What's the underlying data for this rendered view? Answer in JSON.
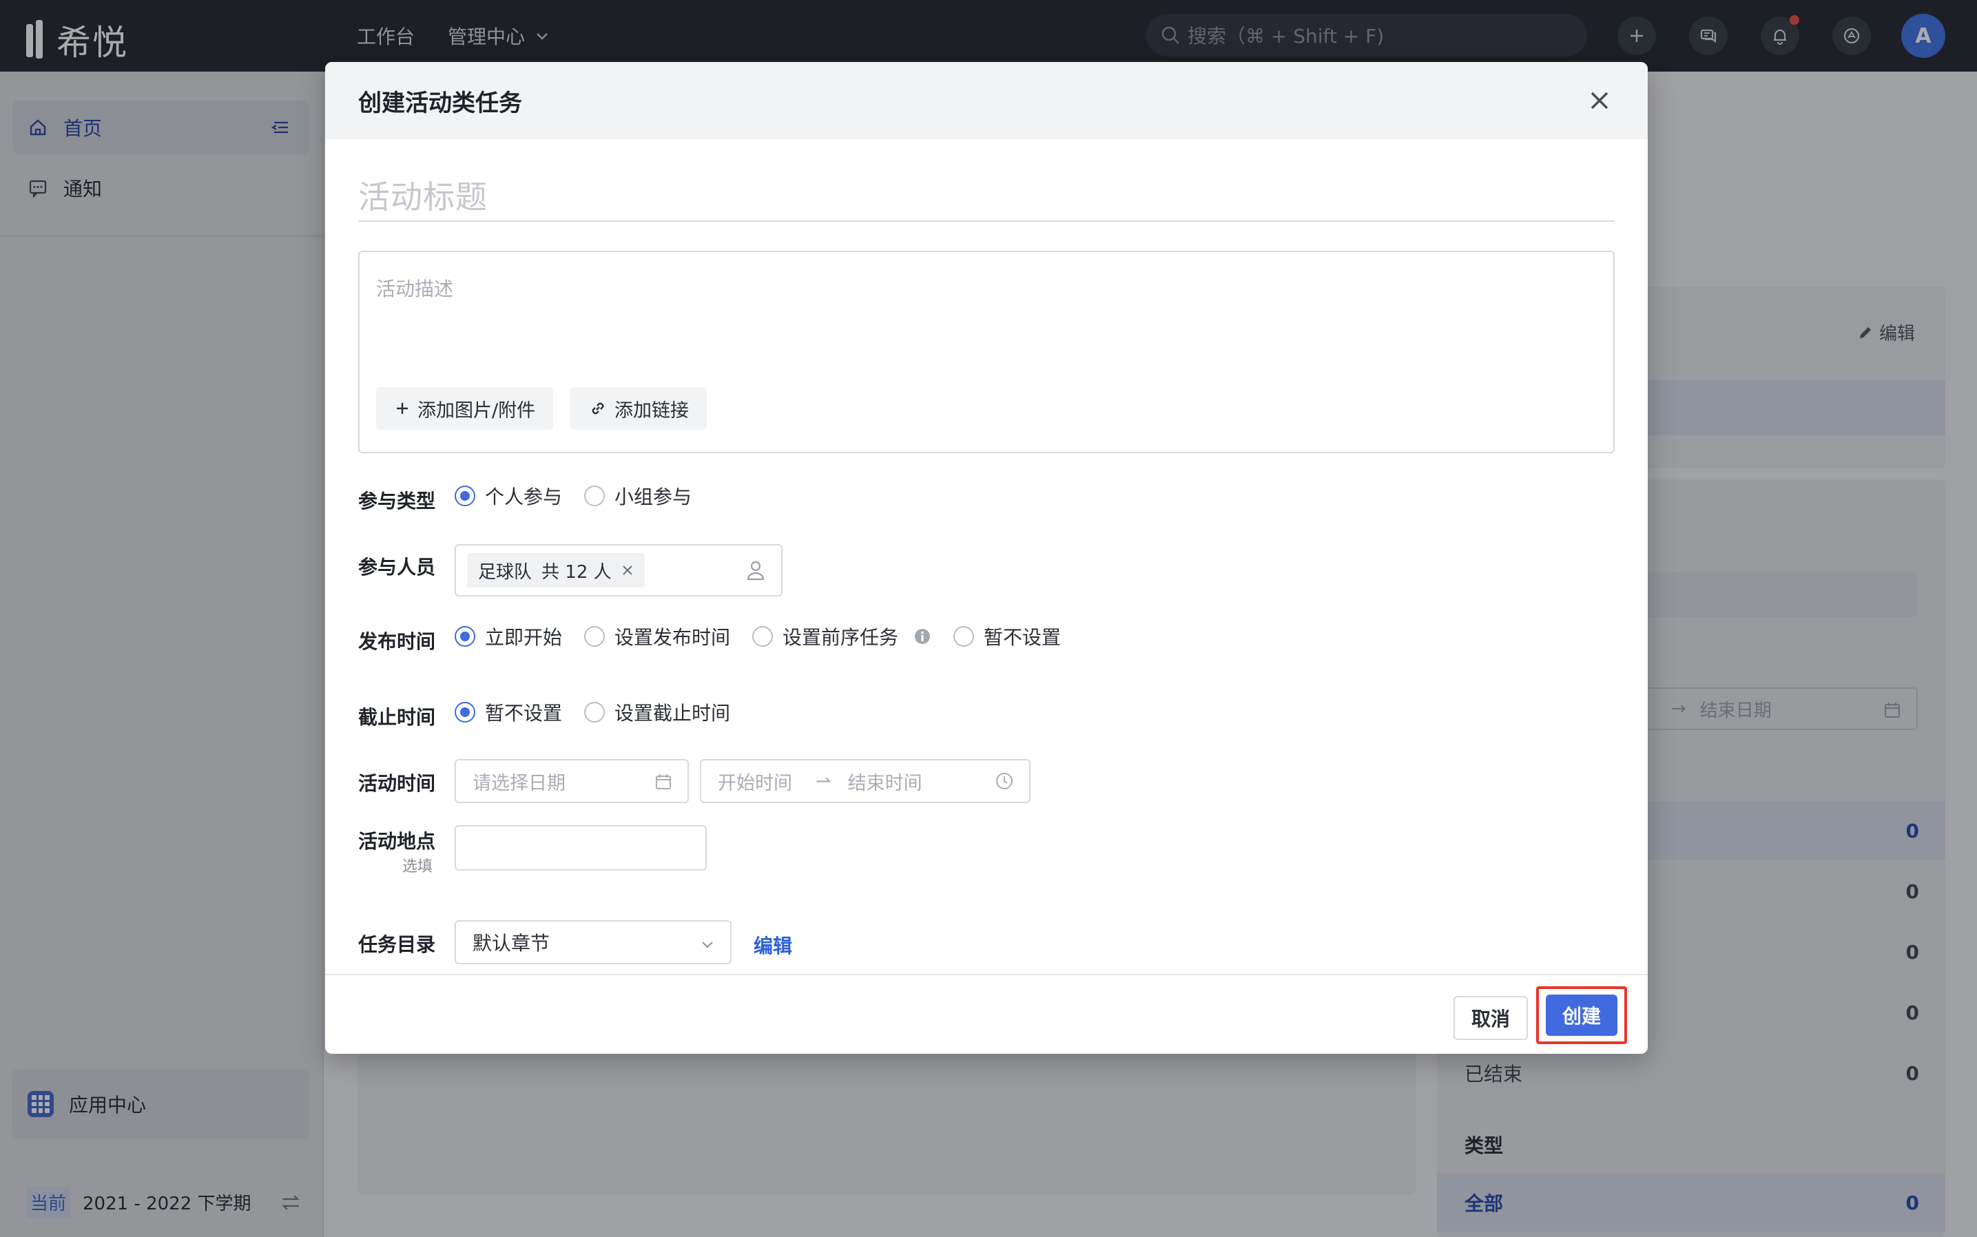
{
  "app": {
    "logo_text": "希悦"
  },
  "topbar": {
    "nav": {
      "workbench": "工作台",
      "admin": "管理中心"
    },
    "search_placeholder": "搜索（⌘ + Shift + F)",
    "avatar_letter": "A"
  },
  "sidebar": {
    "home": "首页",
    "notice": "通知",
    "apps": "应用中心",
    "term_badge": "当前",
    "term": "2021 - 2022 下学期"
  },
  "background": {
    "edit": "编辑",
    "end_date": "结束日期",
    "rows": [
      {
        "label": "",
        "count": "0"
      },
      {
        "label": "",
        "count": "0"
      },
      {
        "label": "",
        "count": "0"
      },
      {
        "label": "",
        "count": "0"
      },
      {
        "label": "已结束",
        "count": "0"
      }
    ],
    "type_heading": "类型",
    "type_all": {
      "label": "全部",
      "count": "0"
    }
  },
  "modal": {
    "title": "创建活动类任务",
    "title_placeholder": "活动标题",
    "desc_placeholder": "活动描述",
    "add_attachment": "添加图片/附件",
    "add_link": "添加链接",
    "participation": {
      "label": "参与类型",
      "options": [
        "个人参与",
        "小组参与"
      ],
      "selected": "个人参与"
    },
    "participants": {
      "label": "参与人员",
      "tag_name": "足球队",
      "tag_count": "共 12 人"
    },
    "publish": {
      "label": "发布时间",
      "options": [
        "立即开始",
        "设置发布时间",
        "设置前序任务",
        "暂不设置"
      ],
      "selected": "立即开始"
    },
    "deadline": {
      "label": "截止时间",
      "options": [
        "暂不设置",
        "设置截止时间"
      ],
      "selected": "暂不设置"
    },
    "activity_time": {
      "label": "活动时间",
      "date_placeholder": "请选择日期",
      "start_placeholder": "开始时间",
      "end_placeholder": "结束时间"
    },
    "location": {
      "label": "活动地点",
      "optional": "选填"
    },
    "catalog": {
      "label": "任务目录",
      "value": "默认章节",
      "edit": "编辑"
    },
    "cancel": "取消",
    "create": "创建"
  },
  "colors": {
    "accent": "#3f6ae0",
    "highlight_border": "#e8362b",
    "topbar": "#1c1f26"
  }
}
